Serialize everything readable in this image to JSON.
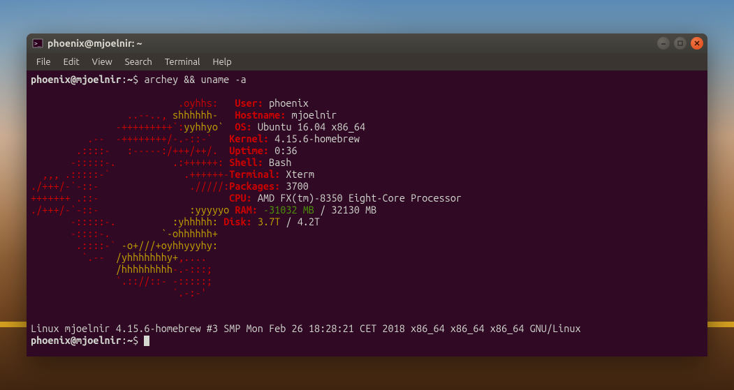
{
  "window": {
    "title": "phoenix@mjoelnir: ~"
  },
  "menu": {
    "file": "File",
    "edit": "Edit",
    "view": "View",
    "search": "Search",
    "terminal": "Terminal",
    "help": "Help"
  },
  "prompt1": {
    "userhost": "phoenix@mjoelnir",
    "pathsep": ":",
    "path": "~",
    "sigil": "$",
    "command": "archey && uname -a"
  },
  "ascii": {
    "l01": "                          .oyhhs:   ",
    "l02a": "                 ..--.., ",
    "l02b": "shhhhhh-   ",
    "l03a": "               -+++++++++`:",
    "l03b": "yyhhyo`  ",
    "l04": "          .--  -++++++++/-.-::-`   ",
    "l05": "        .::::-   :-----:/+++/++/.  ",
    "l06": "       -:::::-.          .:++++++: ",
    "l07": "  ,,, .:::::-`             .++++++-",
    "l08": "./+++/-`-::-                ./////:",
    "l09a": "+++++++ .::-                      ",
    "l09e": " ",
    "l10a": "./+++/-`-::-                ",
    "l10b": ":yyyyyo ",
    "l11a": "       -:::::-.          ",
    "l11b": ":yhhhhh: ",
    "l12a": "       -::::-.         ",
    "l12b": "`-ohhhhhh+  ",
    "l13a": "        .::::-` ",
    "l13b": "-o+///+oyhhyyyhy:   ",
    "l14a": "         `.--  ",
    "l14b": "/yhhhhhhhy+",
    "l14c": ",....     ",
    "l15a": "               ",
    "l15b": "/hhhhhhhhh",
    "l15c": "-.-:::;    ",
    "l16": "               `.:://::- -:::::;   ",
    "l17": "                         `.-:-'    ",
    "l18": "                                   "
  },
  "info": {
    "user_label": "User:",
    "user_val": "phoenix",
    "hostname_label": "Hostname:",
    "hostname_val": "mjoelnir",
    "os_label": "OS:",
    "os_val": "Ubuntu 16.04 x86_64",
    "kernel_label": "Kernel:",
    "kernel_val": "4.15.6-homebrew",
    "uptime_label": "Uptime:",
    "uptime_val": "0:36",
    "shell_label": "Shell:",
    "shell_val": "Bash",
    "terminal_label": "Terminal:",
    "terminal_val": "Xterm",
    "packages_label": "Packages:",
    "packages_val": "3700",
    "cpu_label": "CPU:",
    "cpu_val": "AMD FX(tm)-8350 Eight-Core Processor",
    "ram_label": "RAM:",
    "ram_used": "-31032 MB",
    "ram_sep": " / ",
    "ram_total": "32130 MB",
    "disk_label": "Disk:",
    "disk_used": "3.7T",
    "disk_sep": " / ",
    "disk_total": "4.2T"
  },
  "uname_output": "Linux mjoelnir 4.15.6-homebrew #3 SMP Mon Feb 26 18:28:21 CET 2018 x86_64 x86_64 x86_64 GNU/Linux",
  "prompt2": {
    "userhost": "phoenix@mjoelnir",
    "pathsep": ":",
    "path": "~",
    "sigil": "$"
  }
}
